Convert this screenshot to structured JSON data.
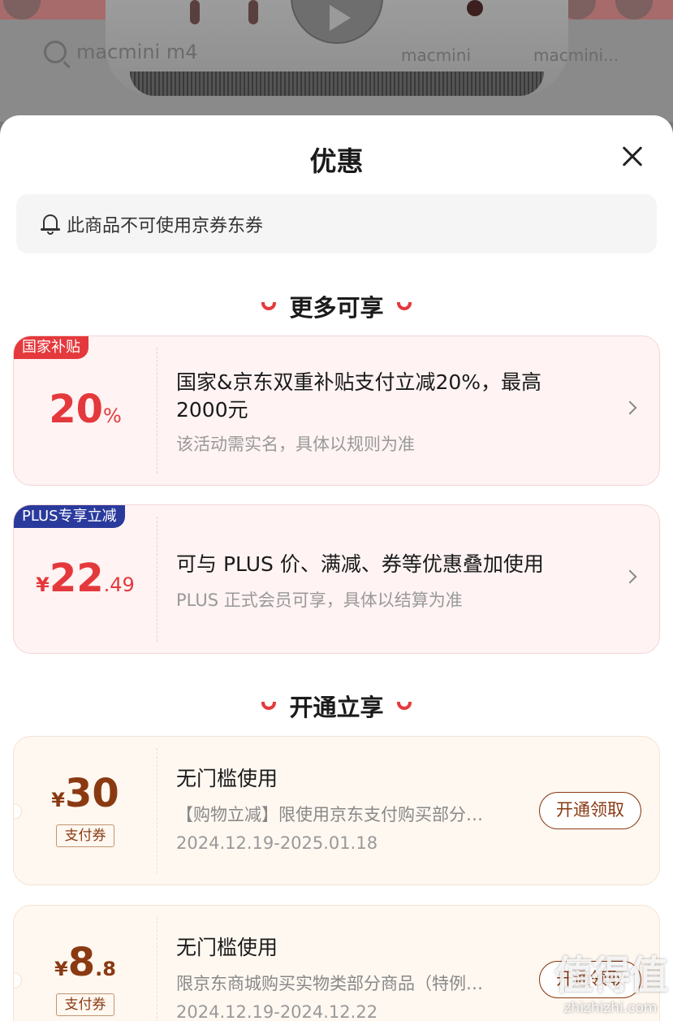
{
  "background": {
    "search_text": "macmini m4",
    "tags": [
      "macmini",
      "macmini..."
    ]
  },
  "sheet": {
    "title": "优惠",
    "notice": "此商品不可使用京券东券"
  },
  "sections": {
    "more": "更多可享",
    "open": "开通立享"
  },
  "offers": [
    {
      "tag": "国家补贴",
      "amount": "20",
      "amount_unit": "%",
      "title_line1": "国家&京东双重补贴支付立减20%，最高",
      "title_line2": "2000元",
      "sub": "该活动需实名，具体以规则为准"
    },
    {
      "tag": "PLUS专享立减",
      "currency": "¥",
      "amount": "22",
      "amount_decimal": ".49",
      "title_line1": "可与 PLUS 价、满减、券等优惠叠加使用",
      "sub": "PLUS 正式会员可享，具体以结算为准"
    }
  ],
  "coupons": [
    {
      "currency": "¥",
      "amount": "30",
      "label": "支付券",
      "title": "无门槛使用",
      "desc": "【购物立减】限使用京东支付购买部分…",
      "date": "2024.12.19-2025.01.18",
      "button": "开通领取"
    },
    {
      "currency": "¥",
      "amount": "8",
      "amount_decimal": ".8",
      "label": "支付券",
      "title": "无门槛使用",
      "desc": "限京东商城购买实物类部分商品（特例…",
      "date": "2024.12.19-2024.12.22",
      "button": "开通领取"
    }
  ],
  "watermark": {
    "logo": "值得值",
    "url": "zhizhizhi.com"
  },
  "colors": {
    "accent_red": "#e4393c",
    "plus_blue": "#2a3a9c",
    "coupon_brown": "#8a3a12"
  }
}
